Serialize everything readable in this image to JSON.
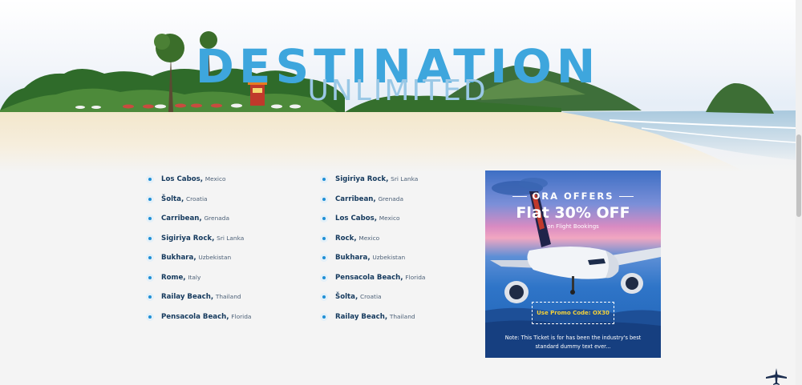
{
  "hero": {
    "title": "DESTINATION",
    "subtitle": "UNLIMITED"
  },
  "destinations": {
    "column1": [
      {
        "city": "Los Cabos,",
        "country": "Mexico"
      },
      {
        "city": "Šolta,",
        "country": "Croatia"
      },
      {
        "city": "Carribean,",
        "country": "Grenada"
      },
      {
        "city": "Sigiriya Rock,",
        "country": "Sri Lanka"
      },
      {
        "city": "Bukhara,",
        "country": "Uzbekistan"
      },
      {
        "city": "Rome,",
        "country": "Italy"
      },
      {
        "city": "Railay Beach,",
        "country": "Thailand"
      },
      {
        "city": "Pensacola Beach,",
        "country": "Florida"
      }
    ],
    "column2": [
      {
        "city": "Sigiriya Rock,",
        "country": "Sri Lanka"
      },
      {
        "city": "Carribean,",
        "country": "Grenada"
      },
      {
        "city": "Los Cabos,",
        "country": "Mexico"
      },
      {
        "city": "Rock,",
        "country": "Mexico"
      },
      {
        "city": "Bukhara,",
        "country": "Uzbekistan"
      },
      {
        "city": "Pensacola Beach,",
        "country": "Florida"
      },
      {
        "city": "Šolta,",
        "country": "Croatia"
      },
      {
        "city": "Railay Beach,",
        "country": "Thailand"
      }
    ]
  },
  "offer": {
    "heading": "ORA OFFERS",
    "main": "Flat 30% OFF",
    "sub": "on Flight Bookings",
    "promo": "Use Promo Code: OX30",
    "note": "Note: This Ticket is for has been the industry's best standard dummy text ever..."
  },
  "icons": {
    "bullet": "dot-bullet-icon",
    "floating": "airplane-icon"
  },
  "colors": {
    "accent": "#1e8fd6",
    "title": "#3ea6dd",
    "text": "#14395d",
    "promo": "#f6d33a"
  }
}
